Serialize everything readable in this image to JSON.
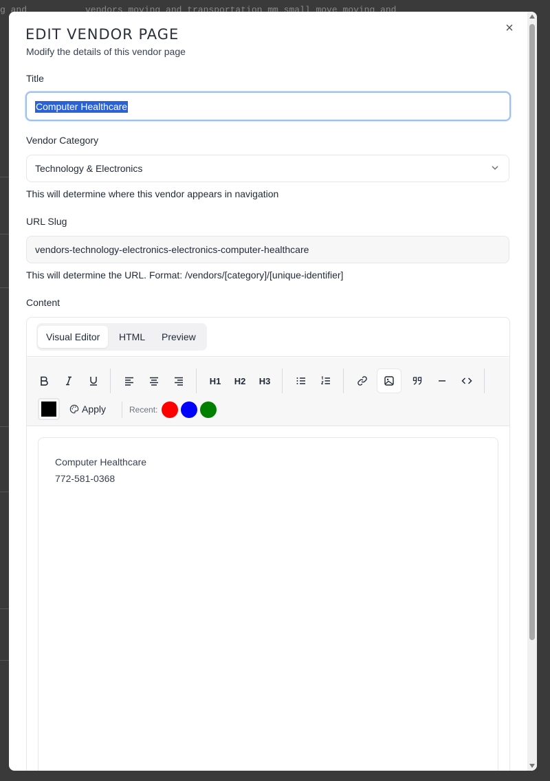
{
  "background": {
    "top_text_left": "g and",
    "top_text_main": "vendors moving and transportation mm small move moving and"
  },
  "modal": {
    "title": "EDIT VENDOR PAGE",
    "subtitle": "Modify the details of this vendor page",
    "close_icon": "close-icon"
  },
  "form": {
    "title_label": "Title",
    "title_value": "Computer Healthcare",
    "category_label": "Vendor Category",
    "category_value": "Technology & Electronics",
    "category_help": "This will determine where this vendor appears in navigation",
    "slug_label": "URL Slug",
    "slug_value": "vendors-technology-electronics-electronics-computer-healthcare",
    "slug_help": "This will determine the URL. Format: /vendors/[category]/[unique-identifier]",
    "content_label": "Content"
  },
  "editor": {
    "tabs": [
      "Visual Editor",
      "HTML",
      "Preview"
    ],
    "active_tab": "Visual Editor",
    "apply_label": "Apply",
    "recent_label": "Recent:",
    "current_color": "#000000",
    "recent_colors": [
      "#ff0000",
      "#0000ff",
      "#008000"
    ],
    "toolbar_icons": [
      "bold-icon",
      "italic-icon",
      "underline-icon",
      "align-left-icon",
      "align-center-icon",
      "align-right-icon",
      "heading-1-icon",
      "heading-2-icon",
      "heading-3-icon",
      "bullet-list-icon",
      "numbered-list-icon",
      "link-icon",
      "image-icon",
      "quote-icon",
      "horizontal-rule-icon",
      "code-icon"
    ],
    "heading_labels": [
      "H1",
      "H2",
      "H3"
    ],
    "content_lines": [
      "Computer Healthcare",
      "772-581-0368"
    ]
  }
}
